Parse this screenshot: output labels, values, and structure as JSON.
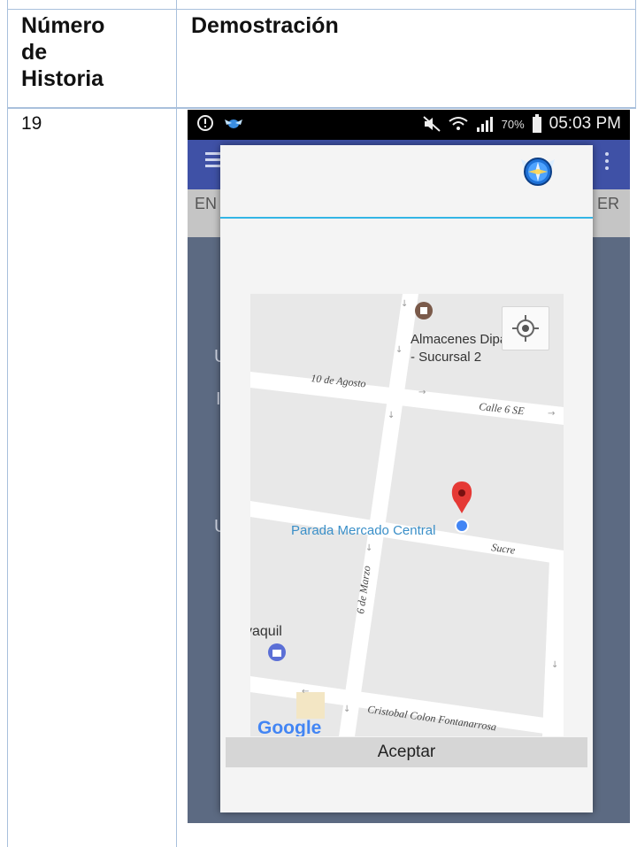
{
  "table": {
    "header_story_number": [
      "Número",
      "de",
      "Historia"
    ],
    "header_demo": "Demostración",
    "row_number": "19"
  },
  "status_bar": {
    "battery_percent": "70%",
    "time": "05:03 PM"
  },
  "dialog": {
    "map": {
      "labels": {
        "poi_store": "Almacenes Dipaso",
        "poi_store_line2": "- Sucursal 2",
        "street_10_agosto": "10 de Agosto",
        "street_calle_6": "Calle 6 SE",
        "stop": "Parada Mercado Central",
        "street_sucre": "Sucre",
        "street_6_marzo": "6 de Marzo",
        "poi_partial": "yaquil",
        "street_cristobal": "Cristobal Colon Fontanarrosa",
        "brand": "Google"
      }
    },
    "accept_label": "Aceptar"
  },
  "colors": {
    "table_border": "#a9c0dc",
    "dialog_accent": "#33b5e5",
    "appbar": "#3f51a6",
    "pin": "#e53935",
    "stop_dot": "#4285f4"
  }
}
